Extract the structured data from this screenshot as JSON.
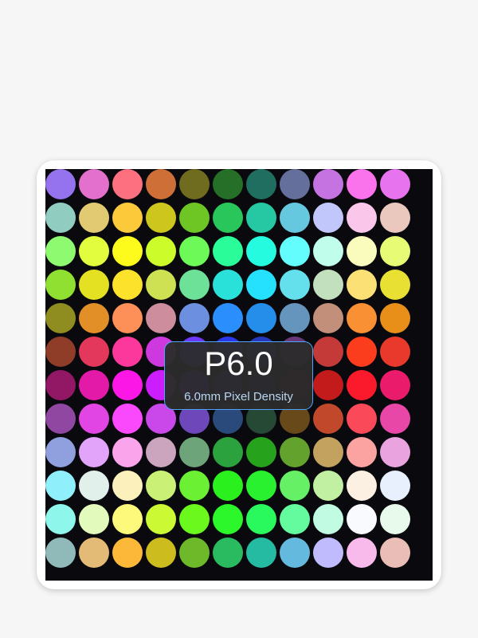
{
  "display": {
    "label": "P6.0",
    "description": "6.0mm Pixel Density",
    "accent_color": "#4da3ff",
    "panel_background": "#0a0a0e"
  },
  "led_grid": {
    "rows": 12,
    "cols": 11,
    "colors": [
      [
        "#9673ee",
        "#e370cc",
        "#fd7080",
        "#cd6f37",
        "#6f6b1f",
        "#256f28",
        "#1f6e5f",
        "#656f9b",
        "#c673e2",
        "#fb73ec",
        "#e873ef"
      ],
      [
        "#90ccc0",
        "#e2ca73",
        "#fcc93a",
        "#cdc71d",
        "#6dc624",
        "#29c65c",
        "#25c8a3",
        "#66c8de",
        "#c1c7fa",
        "#fac7ea",
        "#ebc8be"
      ],
      [
        "#8dfa70",
        "#e2fd3d",
        "#fcfb1c",
        "#cdfc2b",
        "#6df957",
        "#2afc9a",
        "#24fbdf",
        "#63fdfd",
        "#c1fdeb",
        "#fafcbd",
        "#e8fb74"
      ],
      [
        "#90e032",
        "#e3e121",
        "#fde22b",
        "#cde152",
        "#6de198",
        "#2ae1da",
        "#25e1fd",
        "#63e0eb",
        "#c2e0bd",
        "#fae075",
        "#e8e032"
      ],
      [
        "#8f8d20",
        "#e28f28",
        "#fd9059",
        "#cd8d9c",
        "#6d8fdf",
        "#2a8ffd",
        "#258eea",
        "#6594bd",
        "#c2907a",
        "#fa9034",
        "#e88f19"
      ],
      [
        "#8f3c29",
        "#e3385b",
        "#fd389d",
        "#cd38df",
        "#6e38fd",
        "#2a38eb",
        "#2638bb",
        "#683879",
        "#c33a39",
        "#fb3c1d",
        "#e9392d"
      ],
      [
        "#921765",
        "#e31aa8",
        "#fb18e6",
        "#cc1dfc",
        "#6f1ae9",
        "#2a18b8",
        "#261778",
        "#681634",
        "#c31a1c",
        "#fa1a2b",
        "#ea1b6b"
      ],
      [
        "#8f47a2",
        "#e145e3",
        "#fa48fc",
        "#ca48e9",
        "#6e48bb",
        "#294a7a",
        "#264935",
        "#684919",
        "#c2482c",
        "#fa4a5a",
        "#e947a8"
      ],
      [
        "#909fdd",
        "#e2a4fb",
        "#faa4eb",
        "#caa5bd",
        "#6ea479",
        "#2ba23d",
        "#27a21d",
        "#64a22e",
        "#c2a25e",
        "#faa3a0",
        "#e9a3de"
      ],
      [
        "#8ff0fc",
        "#e2f0eb",
        "#fcf0bc",
        "#cbf076",
        "#6cf034",
        "#2af01d",
        "#29f12f",
        "#65f065",
        "#c2f0a3",
        "#fbf0e1",
        "#e9f0fd"
      ],
      [
        "#8ff6eb",
        "#e2fabb",
        "#fcf97b",
        "#cbf934",
        "#6af81d",
        "#2bf72a",
        "#29f95d",
        "#64fb9e",
        "#c1fbe1",
        "#f9fafd",
        "#e8faeb"
      ],
      [
        "#90bab9",
        "#e3bb76",
        "#fcb939",
        "#cdbc1e",
        "#6db92a",
        "#2aba5f",
        "#25bba2",
        "#64bade",
        "#c0bbfc",
        "#f8baeb",
        "#eabdb6"
      ]
    ]
  }
}
